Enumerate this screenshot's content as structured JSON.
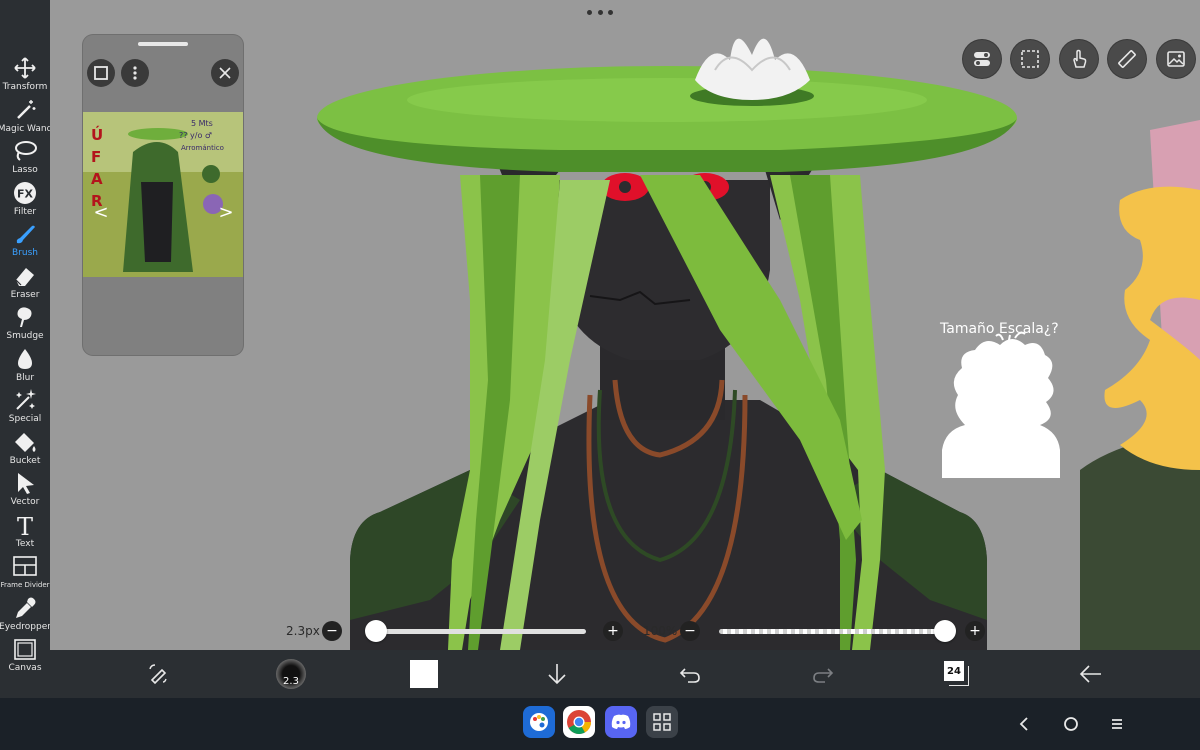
{
  "tools": [
    {
      "id": "transform",
      "label": "Transform",
      "icon": "transform-icon"
    },
    {
      "id": "magic-wand",
      "label": "Magic Wand",
      "icon": "magic-wand-icon"
    },
    {
      "id": "lasso",
      "label": "Lasso",
      "icon": "lasso-icon"
    },
    {
      "id": "filter",
      "label": "Filter",
      "icon": "fx-icon"
    },
    {
      "id": "brush",
      "label": "Brush",
      "icon": "brush-icon",
      "active": true
    },
    {
      "id": "eraser",
      "label": "Eraser",
      "icon": "eraser-icon"
    },
    {
      "id": "smudge",
      "label": "Smudge",
      "icon": "smudge-icon"
    },
    {
      "id": "blur",
      "label": "Blur",
      "icon": "blur-drop-icon"
    },
    {
      "id": "special",
      "label": "Special",
      "icon": "sparkle-icon"
    },
    {
      "id": "bucket",
      "label": "Bucket",
      "icon": "bucket-icon"
    },
    {
      "id": "vector",
      "label": "Vector",
      "icon": "cursor-arrow-icon"
    },
    {
      "id": "text",
      "label": "Text",
      "icon": "text-t-icon"
    },
    {
      "id": "frame-divider",
      "label": "Frame Divider",
      "icon": "frame-divider-icon"
    },
    {
      "id": "eyedropper",
      "label": "Eyedropper",
      "icon": "eyedropper-icon"
    },
    {
      "id": "canvas",
      "label": "Canvas",
      "icon": "canvas-icon"
    }
  ],
  "filter_glyph": "FX",
  "text_glyph": "T",
  "reference": {
    "art_text_vertical": "ÚFAR",
    "art_note_1": "5 Mts",
    "art_note_2": "?? y/o ♂",
    "art_note_3": "Arromántico",
    "prev_glyph": "<",
    "next_glyph": ">"
  },
  "canvas_note": "Tamaño Escala¿?",
  "brush_size": {
    "value_label": "2.3px",
    "level": 0.02
  },
  "opacity": {
    "value_label": "100%",
    "level": 1.0
  },
  "minus_glyph": "−",
  "plus_glyph": "+",
  "toolbar": {
    "brush_preview_number": "2.3",
    "layers_count": "24"
  },
  "colors": {
    "accent": "#3aa0ff",
    "sidebar": "#2b2f33",
    "workspace": "#9a9a9a",
    "hat_green": "#6fb33c",
    "skin_dark": "#2b2a2d",
    "eye_red": "#e0102a",
    "current_color": "#ffffff"
  },
  "taskbar_apps": [
    {
      "name": "ibis-paint-app-icon"
    },
    {
      "name": "chrome-app-icon"
    },
    {
      "name": "discord-app-icon"
    },
    {
      "name": "app-grid-icon"
    }
  ]
}
